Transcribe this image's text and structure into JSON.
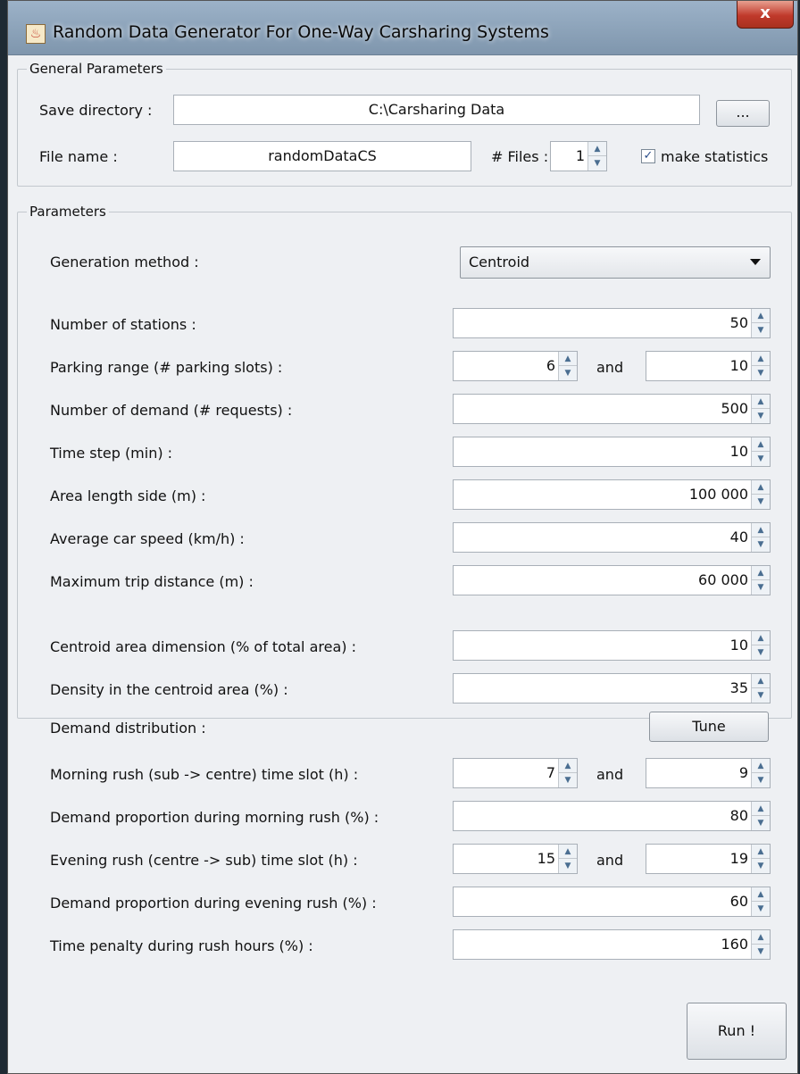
{
  "window": {
    "title": "Random Data Generator For One-Way Carsharing Systems",
    "close_label": "x"
  },
  "general": {
    "group_title": "General Parameters",
    "save_dir_label": "Save directory :",
    "save_dir_value": "C:\\Carsharing Data",
    "browse_label": "...",
    "file_name_label": "File name :",
    "file_name_value": "randomDataCS",
    "files_label": "# Files :",
    "files_value": "1",
    "make_stats_label": "make statistics",
    "make_stats_checked": true
  },
  "params": {
    "group_title": "Parameters",
    "generation_method_label": "Generation method  :",
    "generation_method_value": "Centroid",
    "and_label": "and",
    "stations_label": "Number of stations :",
    "stations_value": "50",
    "parking_label": "Parking range (# parking slots) :",
    "parking_min": "6",
    "parking_max": "10",
    "demand_label": "Number of demand (# requests) :",
    "demand_value": "500",
    "timestep_label": "Time step (min) :",
    "timestep_value": "10",
    "area_label": "Area length side (m) :",
    "area_value": "100 000",
    "speed_label": "Average car speed (km/h) :",
    "speed_value": "40",
    "trip_label": "Maximum trip distance (m) :",
    "trip_value": "60 000",
    "centroid_area_label": "Centroid area dimension (% of total area) :",
    "centroid_area_value": "10",
    "density_label": "Density in the centroid area (%) :",
    "density_value": "35",
    "distribution_label": "Demand distribution :",
    "tune_label": "Tune",
    "morning_slot_label": "Morning rush (sub -> centre) time slot (h) :",
    "morning_from": "7",
    "morning_to": "9",
    "morning_prop_label": "Demand proportion during morning rush (%) :",
    "morning_prop_value": "80",
    "evening_slot_label": "Evening rush (centre -> sub) time slot (h) :",
    "evening_from": "15",
    "evening_to": "19",
    "evening_prop_label": "Demand proportion during evening rush (%) :",
    "evening_prop_value": "60",
    "penalty_label": "Time penalty during rush hours (%) :",
    "penalty_value": "160"
  },
  "run_label": "Run !"
}
